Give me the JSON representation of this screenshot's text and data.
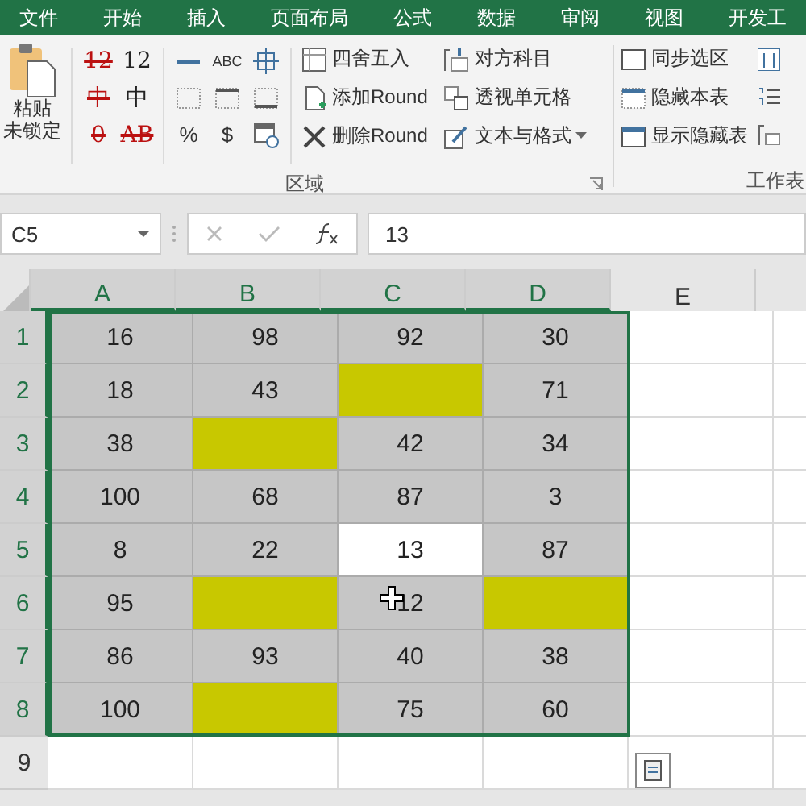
{
  "menu_tabs": [
    "文件",
    "开始",
    "插入",
    "页面布局",
    "公式",
    "数据",
    "审阅",
    "视图",
    "开发工"
  ],
  "ribbon": {
    "paste": {
      "line_1": "粘贴",
      "line_2": "未锁定"
    },
    "glyph_buttons": [
      {
        "label": "12",
        "struck": true
      },
      {
        "label": "12",
        "struck": false
      },
      {
        "label": "中",
        "struck": true
      },
      {
        "label": "中",
        "struck": false
      },
      {
        "label": "0",
        "struck": true
      },
      {
        "label": "AB",
        "struck": true
      }
    ],
    "format_buttons": [
      {
        "kind": "dash"
      },
      {
        "kind": "text",
        "label": "ABC"
      },
      {
        "kind": "center"
      },
      {
        "kind": "grid"
      },
      {
        "kind": "gridtop"
      },
      {
        "kind": "gridbottom"
      },
      {
        "kind": "text",
        "label": "%"
      },
      {
        "kind": "text",
        "label": "$"
      },
      {
        "kind": "calendar"
      }
    ],
    "column_1": [
      {
        "kind": "round",
        "label": "四舍五入"
      },
      {
        "kind": "add",
        "label": "添加Round"
      },
      {
        "kind": "delete",
        "label": "删除Round"
      }
    ],
    "column_2": [
      {
        "kind": "account",
        "label": "对方科目",
        "dropdown": false
      },
      {
        "kind": "pivot",
        "label": "透视单元格",
        "dropdown": false
      },
      {
        "kind": "edit",
        "label": "文本与格式",
        "dropdown": true
      }
    ],
    "group_1_label": "区域",
    "sheet_options": [
      {
        "kind": "checkbox",
        "label": "同步选区"
      },
      {
        "kind": "hide",
        "label": "隐藏本表"
      },
      {
        "kind": "show",
        "label": "显示隐藏表"
      }
    ],
    "group_2_label": "工作表"
  },
  "formula_bar": {
    "name_box": "C5",
    "value": "13"
  },
  "columns": [
    "A",
    "B",
    "C",
    "D",
    "E"
  ],
  "rows": [
    {
      "header": "1",
      "cells": [
        {
          "value": "16",
          "highlight": false,
          "active": false
        },
        {
          "value": "98",
          "highlight": false,
          "active": false
        },
        {
          "value": "92",
          "highlight": false,
          "active": false
        },
        {
          "value": "30",
          "highlight": false,
          "active": false
        }
      ]
    },
    {
      "header": "2",
      "cells": [
        {
          "value": "18",
          "highlight": false,
          "active": false
        },
        {
          "value": "43",
          "highlight": false,
          "active": false
        },
        {
          "highlight": true,
          "active": false
        },
        {
          "value": "71",
          "highlight": false,
          "active": false
        }
      ]
    },
    {
      "header": "3",
      "cells": [
        {
          "value": "38",
          "highlight": false,
          "active": false
        },
        {
          "highlight": true,
          "active": false
        },
        {
          "value": "42",
          "highlight": false,
          "active": false
        },
        {
          "value": "34",
          "highlight": false,
          "active": false
        }
      ]
    },
    {
      "header": "4",
      "cells": [
        {
          "value": "100",
          "highlight": false,
          "active": false
        },
        {
          "value": "68",
          "highlight": false,
          "active": false
        },
        {
          "value": "87",
          "highlight": false,
          "active": false
        },
        {
          "value": "3",
          "highlight": false,
          "active": false
        }
      ]
    },
    {
      "header": "5",
      "cells": [
        {
          "value": "8",
          "highlight": false,
          "active": false
        },
        {
          "value": "22",
          "highlight": false,
          "active": false
        },
        {
          "value": "13",
          "highlight": false,
          "active": true
        },
        {
          "value": "87",
          "highlight": false,
          "active": false
        }
      ]
    },
    {
      "header": "6",
      "cells": [
        {
          "value": "95",
          "highlight": false,
          "active": false
        },
        {
          "highlight": true,
          "active": false
        },
        {
          "value": "12",
          "highlight": false,
          "active": false
        },
        {
          "highlight": true,
          "active": false
        }
      ]
    },
    {
      "header": "7",
      "cells": [
        {
          "value": "86",
          "highlight": false,
          "active": false
        },
        {
          "value": "93",
          "highlight": false,
          "active": false
        },
        {
          "value": "40",
          "highlight": false,
          "active": false
        },
        {
          "value": "38",
          "highlight": false,
          "active": false
        }
      ]
    },
    {
      "header": "8",
      "cells": [
        {
          "value": "100",
          "highlight": false,
          "active": false
        },
        {
          "highlight": true,
          "active": false
        },
        {
          "value": "75",
          "highlight": false,
          "active": false
        },
        {
          "value": "60",
          "highlight": false,
          "active": false
        }
      ]
    },
    {
      "header": "9",
      "cells": []
    }
  ]
}
